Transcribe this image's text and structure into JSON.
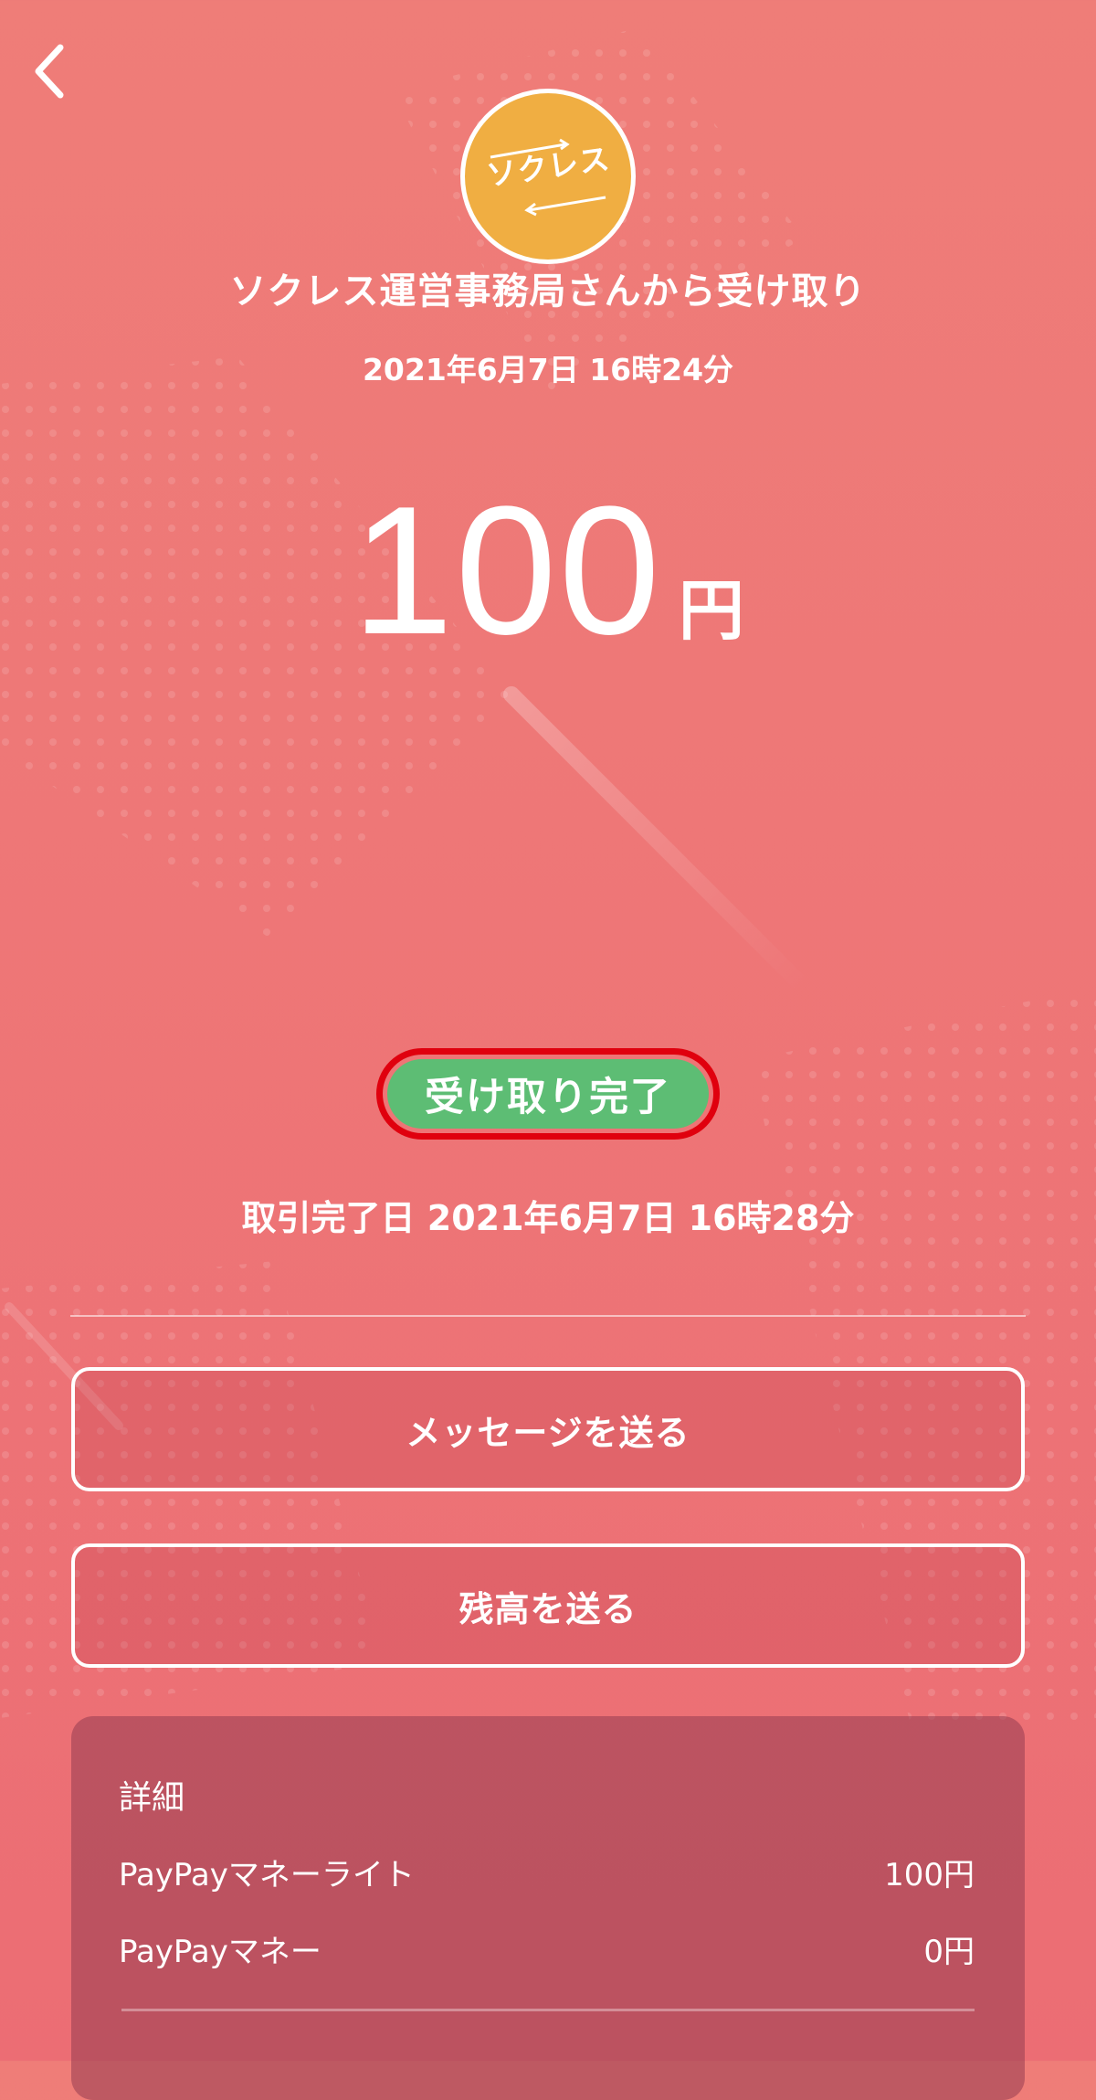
{
  "header": {
    "logo_text": "ソクレス",
    "sender_title": "ソクレス運営事務局さんから受け取り",
    "sent_date": "2021年6月7日 16時24分"
  },
  "amount": {
    "value": "100",
    "unit": "円"
  },
  "status": {
    "badge_label": "受け取り完了",
    "completed_label": "取引完了日",
    "completed_date": "2021年6月7日 16時28分",
    "highlight_color": "#e0000e",
    "badge_color": "#5dbd74"
  },
  "actions": {
    "send_message": "メッセージを送る",
    "send_balance": "残高を送る"
  },
  "details": {
    "title": "詳細",
    "rows": [
      {
        "label": "PayPayマネーライト",
        "value": "100円"
      },
      {
        "label": "PayPayマネー",
        "value": "0円"
      }
    ]
  },
  "theme": {
    "background": "#ee7777",
    "logo_color": "#f0ae42"
  },
  "icons": {
    "back": "chevron-left-icon"
  }
}
